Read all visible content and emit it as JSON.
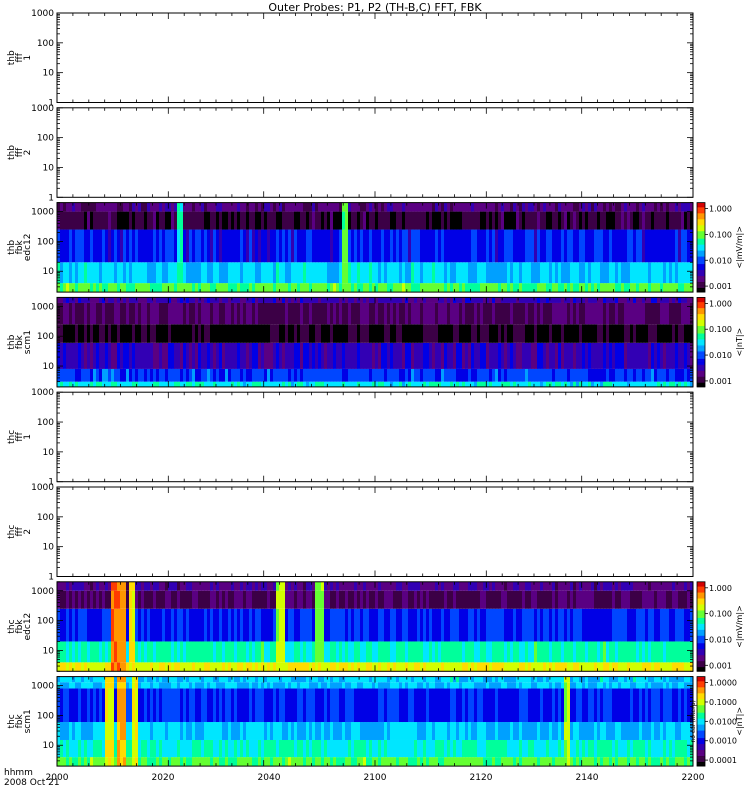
{
  "title": "Outer Probes: P1, P2 (TH-B,C) FFT, FBK",
  "time_axis": {
    "labels": [
      "2000",
      "2020",
      "2040",
      "2100",
      "2120",
      "2140",
      "2200"
    ],
    "line1": "hhmm",
    "line2": "2008 Oct 21"
  },
  "colormap": [
    "#000000",
    "#3c0046",
    "#5a0082",
    "#3200b4",
    "#0000e6",
    "#0046ff",
    "#00a0ff",
    "#00e6ff",
    "#00ff9b",
    "#64ff32",
    "#d2ff00",
    "#ffdc00",
    "#ff9600",
    "#ff3c00",
    "#d20000"
  ],
  "chart_data": [
    {
      "type": "heatmap",
      "id": "thb-fff-1",
      "ylabel": [
        "thb",
        "fff",
        "1"
      ],
      "ylim": [
        1,
        1000
      ],
      "yscale": "log",
      "yticks": [
        "1",
        "10",
        "100",
        "1000"
      ],
      "has_data": false,
      "colorbar": null
    },
    {
      "type": "heatmap",
      "id": "thb-fff-2",
      "ylabel": [
        "thb",
        "fff",
        "2"
      ],
      "ylim": [
        1,
        1000
      ],
      "yscale": "log",
      "yticks": [
        "1",
        "10",
        "100",
        "1000"
      ],
      "has_data": false,
      "colorbar": null
    },
    {
      "type": "heatmap",
      "id": "thb-fbk-edc12",
      "ylabel": [
        "thb",
        "fbk",
        "edc12"
      ],
      "ylim": [
        2,
        2000
      ],
      "yscale": "log",
      "yticks": [
        "10",
        "100",
        "1000"
      ],
      "has_data": true,
      "bands": [
        {
          "y": [
            2,
            4
          ],
          "level": 0.62
        },
        {
          "y": [
            4,
            20
          ],
          "level": 0.48
        },
        {
          "y": [
            20,
            250
          ],
          "level": 0.3
        },
        {
          "y": [
            250,
            1000
          ],
          "level": 0.06
        },
        {
          "y": [
            1000,
            2000
          ],
          "level": 0.14
        }
      ],
      "stripes": [
        {
          "t": 0.19,
          "level": 0.52
        },
        {
          "t": 0.45,
          "level": 0.6
        }
      ],
      "colorbar": {
        "label": "<|mV/m|>",
        "ticks": [
          "0.001",
          "0.010",
          "0.100",
          "1.000"
        ]
      }
    },
    {
      "type": "heatmap",
      "id": "thb-fbk-scm1",
      "ylabel": [
        "thb",
        "fbk",
        "scm1"
      ],
      "ylim": [
        2,
        2000
      ],
      "yscale": "log",
      "yticks": [
        "10",
        "100",
        "1000"
      ],
      "has_data": true,
      "bands": [
        {
          "y": [
            2,
            3
          ],
          "level": 0.52
        },
        {
          "y": [
            3,
            8
          ],
          "level": 0.34
        },
        {
          "y": [
            8,
            60
          ],
          "level": 0.22
        },
        {
          "y": [
            60,
            250
          ],
          "level": 0.02
        },
        {
          "y": [
            250,
            1300
          ],
          "level": 0.1
        },
        {
          "y": [
            1300,
            2000
          ],
          "level": 0.2
        }
      ],
      "stripes": [],
      "colorbar": {
        "label": "<|nT|>",
        "ticks": [
          "0.001",
          "0.010",
          "0.100",
          "1.000"
        ]
      }
    },
    {
      "type": "heatmap",
      "id": "thc-fff-1",
      "ylabel": [
        "thc",
        "fff",
        "1"
      ],
      "ylim": [
        1,
        1000
      ],
      "yscale": "log",
      "yticks": [
        "1",
        "10",
        "100",
        "1000"
      ],
      "has_data": false,
      "colorbar": null
    },
    {
      "type": "heatmap",
      "id": "thc-fff-2",
      "ylabel": [
        "thc",
        "fff",
        "2"
      ],
      "ylim": [
        1,
        1000
      ],
      "yscale": "log",
      "yticks": [
        "1",
        "10",
        "100",
        "1000"
      ],
      "has_data": false,
      "colorbar": null
    },
    {
      "type": "heatmap",
      "id": "thc-fbk-edc12",
      "ylabel": [
        "thc",
        "fbk",
        "edc12"
      ],
      "ylim": [
        2,
        2000
      ],
      "yscale": "log",
      "yticks": [
        "10",
        "100",
        "1000"
      ],
      "has_data": true,
      "bands": [
        {
          "y": [
            2,
            4
          ],
          "level": 0.74
        },
        {
          "y": [
            4,
            20
          ],
          "level": 0.55
        },
        {
          "y": [
            20,
            250
          ],
          "level": 0.32
        },
        {
          "y": [
            250,
            1000
          ],
          "level": 0.1
        },
        {
          "y": [
            1000,
            2000
          ],
          "level": 0.16
        }
      ],
      "stripes": [
        {
          "t": 0.09,
          "level": 0.86
        },
        {
          "t": 0.1,
          "level": 0.82
        },
        {
          "t": 0.115,
          "level": 0.72
        },
        {
          "t": 0.35,
          "level": 0.66
        },
        {
          "t": 0.41,
          "level": 0.62
        }
      ],
      "colorbar": {
        "label": "<|mV/m|>",
        "ticks": [
          "0.001",
          "0.010",
          "0.100",
          "1.000"
        ]
      }
    },
    {
      "type": "heatmap",
      "id": "thc-fbk-scm1",
      "ylabel": [
        "thc",
        "fbk",
        "scm1"
      ],
      "ylim": [
        2,
        2000
      ],
      "yscale": "log",
      "yticks": [
        "10",
        "100",
        "1000"
      ],
      "has_data": true,
      "bands": [
        {
          "y": [
            2,
            4
          ],
          "level": 0.62
        },
        {
          "y": [
            4,
            15
          ],
          "level": 0.54
        },
        {
          "y": [
            15,
            60
          ],
          "level": 0.46
        },
        {
          "y": [
            60,
            800
          ],
          "level": 0.32
        },
        {
          "y": [
            800,
            1300
          ],
          "level": 0.46
        },
        {
          "y": [
            1300,
            2000
          ],
          "level": 0.48
        }
      ],
      "stripes": [
        {
          "t": 0.08,
          "level": 0.72
        },
        {
          "t": 0.1,
          "level": 0.78
        },
        {
          "t": 0.12,
          "level": 0.7
        },
        {
          "t": 0.8,
          "level": 0.64
        }
      ],
      "colorbar": {
        "label": "<|nT|>",
        "ticks": [
          "0.0001",
          "0.0010",
          "0.0100",
          "0.1000",
          "1.0000"
        ],
        "extra": "no cal (interp)"
      }
    }
  ]
}
